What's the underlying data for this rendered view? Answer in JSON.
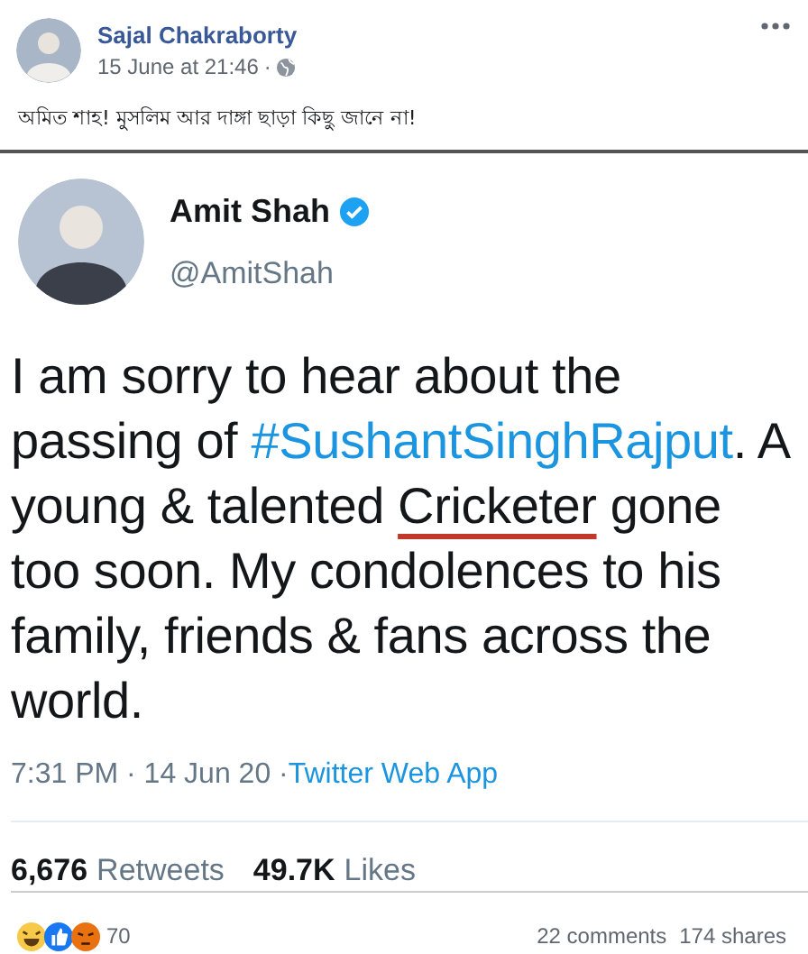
{
  "post": {
    "author": "Sajal Chakraborty",
    "time": "15 June at 21:46",
    "separator": "·",
    "text": "অমিত শাহ! মুসলিম আর দাঙ্গা ছাড়া কিছু জানে না!"
  },
  "tweet": {
    "name": "Amit Shah",
    "verified": true,
    "handle": "@AmitShah",
    "segments": [
      {
        "kind": "plain",
        "text": "I am sorry to hear about the passing of "
      },
      {
        "kind": "hashtag",
        "text": "#SushantSinghRajput"
      },
      {
        "kind": "plain",
        "text": ". A young & talented "
      },
      {
        "kind": "marked",
        "text": "Cricketer"
      },
      {
        "kind": "plain",
        "text": " gone too soon. My condolences to his family, friends & fans across the world."
      }
    ],
    "time": "7:31 PM · 14 Jun 20 · ",
    "source": "Twitter Web App",
    "stats": [
      {
        "count": "6,676",
        "label": "Retweets"
      },
      {
        "count": "49.7K",
        "label": "Likes"
      }
    ]
  },
  "reactions": {
    "emojis": [
      {
        "kind": "haha"
      },
      {
        "kind": "like"
      },
      {
        "kind": "angry"
      }
    ],
    "count": "70",
    "comments": "22 comments",
    "shares": "174 shares"
  }
}
